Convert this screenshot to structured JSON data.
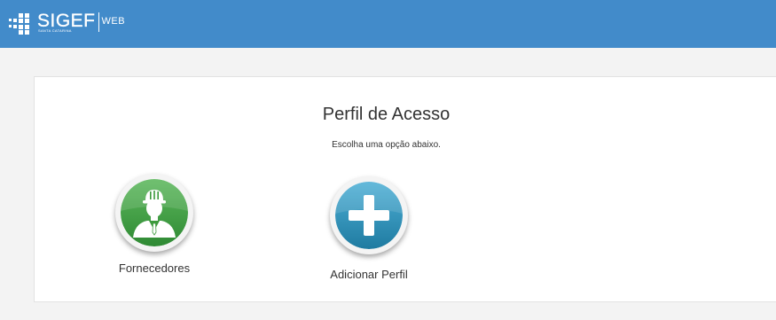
{
  "header": {
    "logo_main": "SIGEF",
    "logo_sub": "SANTA CATARINA",
    "logo_suffix": "WEB",
    "background_color": "#428bca"
  },
  "main": {
    "title": "Perfil de Acesso",
    "subtitle": "Escolha uma opção abaixo.",
    "options": [
      {
        "label": "Fornecedores",
        "icon": "worker-helmet-icon",
        "color": "#3c9a3c"
      },
      {
        "label": "Adicionar Perfil",
        "icon": "plus-icon",
        "color": "#2e8fb4"
      }
    ]
  }
}
